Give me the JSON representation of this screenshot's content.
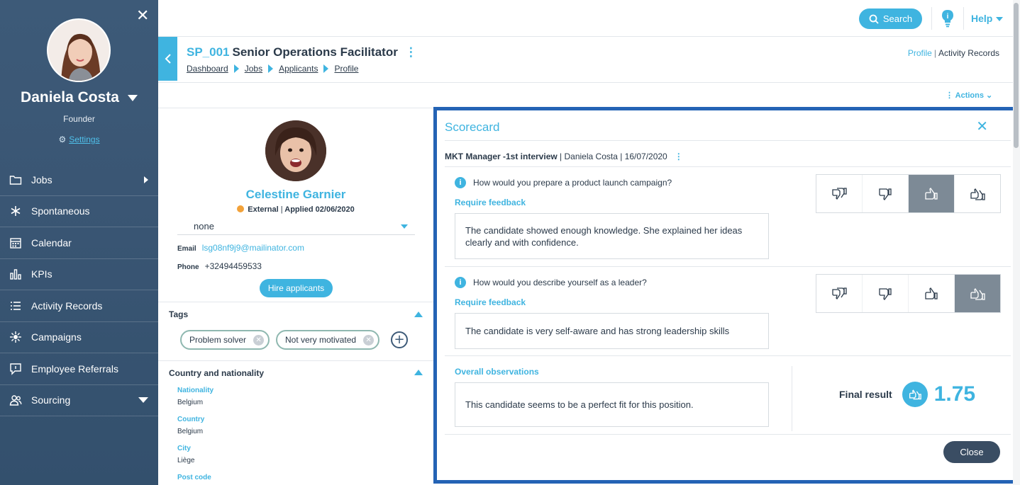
{
  "sidebar": {
    "user_name": "Daniela Costa",
    "user_role": "Founder",
    "settings_label": "Settings",
    "close_glyph": "✕",
    "items": [
      {
        "label": "Jobs",
        "icon": "folder-icon"
      },
      {
        "label": "Spontaneous",
        "icon": "asterisk-icon"
      },
      {
        "label": "Calendar",
        "icon": "calendar-icon"
      },
      {
        "label": "KPIs",
        "icon": "bar-chart-icon"
      },
      {
        "label": "Activity Records",
        "icon": "list-icon"
      },
      {
        "label": "Campaigns",
        "icon": "spark-icon"
      },
      {
        "label": "Employee Referrals",
        "icon": "chat-icon"
      },
      {
        "label": "Sourcing",
        "icon": "users-icon"
      }
    ]
  },
  "topbar": {
    "search_label": "Search",
    "help_label": "Help"
  },
  "job": {
    "code": "SP_001",
    "title": "Senior Operations Facilitator",
    "breadcrumb": [
      "Dashboard",
      "Jobs",
      "Applicants",
      "Profile"
    ],
    "tabs": {
      "profile": "Profile",
      "activity": "Activity Records"
    },
    "actions_label": "Actions"
  },
  "candidate": {
    "name": "Celestine Garnier",
    "source": "External",
    "applied": "Applied 02/06/2020",
    "status_value": "none",
    "email_label": "Email",
    "email": "lsg08nf9j9@mailinator.com",
    "phone_label": "Phone",
    "phone": "+32494459533",
    "hire_label": "Hire applicants",
    "tags_title": "Tags",
    "tags": [
      "Problem solver",
      "Not very motivated"
    ],
    "country_title": "Country and nationality",
    "fields": [
      {
        "label": "Nationality",
        "value": "Belgium"
      },
      {
        "label": "Country",
        "value": "Belgium"
      },
      {
        "label": "City",
        "value": "Liège"
      },
      {
        "label": "Post code",
        "value": ""
      }
    ]
  },
  "scorecard": {
    "title": "Scorecard",
    "interview": "MKT Manager -1st interview",
    "interviewer": "Daniela Costa",
    "date": "16/07/2020",
    "questions": [
      {
        "question": "How would you prepare a product launch campaign?",
        "require_label": "Require feedback",
        "answer": "The candidate showed enough knowledge. She explained her ideas clearly and with confidence.",
        "selected_rating": 3
      },
      {
        "question": "How would you describe yourself as a leader?",
        "require_label": "Require feedback",
        "answer": "The candidate is very self-aware and has strong leadership skills",
        "selected_rating": 4
      }
    ],
    "observations_label": "Overall observations",
    "observations": "This candidate seems to be a perfect fit for this position.",
    "final_label": "Final result",
    "final_score": "1.75",
    "close_label": "Close"
  },
  "colors": {
    "accent": "#3fb4e0",
    "sidebar": "#3d5a78",
    "modal_border": "#2463b5",
    "selected_rating": "#7d8a96"
  }
}
